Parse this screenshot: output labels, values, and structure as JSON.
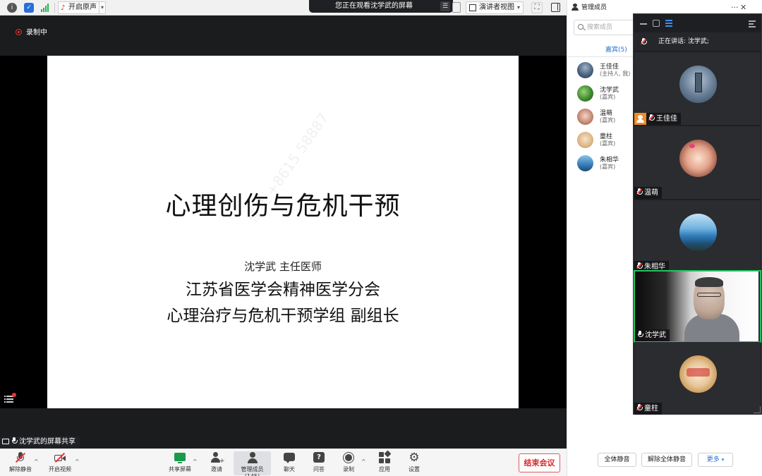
{
  "toolbar": {
    "original_sound": "开启原声",
    "presenter_view": "演讲者视图",
    "viewing_banner": "您正在观看沈学武的屏幕"
  },
  "recording": "录制中",
  "slide": {
    "title": "心理创伤与危机干预",
    "presenter": "沈学武  主任医师",
    "org": "江苏省医学会精神医学分会",
    "group": "心理治疗与危机干预学组  副组长",
    "watermark": "佳佳 +8615  58887"
  },
  "share_label": "沈学武的屏幕共享",
  "bottom": {
    "unmute": "解除静音",
    "video": "开启视频",
    "share": "共享屏幕",
    "invite": "邀请",
    "manage": "管理成员(145)",
    "chat": "聊天",
    "qa": "问答",
    "record": "录制",
    "apps": "应用",
    "settings": "设置",
    "end": "结束会议"
  },
  "panel": {
    "title": "管理成员",
    "search_placeholder": "搜索成员",
    "guests_tab": "嘉宾(5)",
    "members": [
      {
        "name": "王佳佳",
        "role": "(主持人, 我)"
      },
      {
        "name": "沈学武",
        "role": "(嘉宾)"
      },
      {
        "name": "温萌",
        "role": "(嘉宾)"
      },
      {
        "name": "童柱",
        "role": "(嘉宾)"
      },
      {
        "name": "朱相华",
        "role": "(嘉宾)"
      }
    ],
    "mute_all": "全体静音",
    "unmute_all": "解除全体静音",
    "more": "更多"
  },
  "gallery": {
    "speaking": "正在讲话: 沈学武;",
    "tiles": [
      {
        "name": "王佳佳"
      },
      {
        "name": "温萌"
      },
      {
        "name": "朱相华"
      },
      {
        "name": "沈学武"
      },
      {
        "name": "童柱"
      }
    ]
  },
  "colors": {
    "accent": "#2a6fd6",
    "danger": "#d6262a",
    "active_speaker": "#22c35e",
    "host_badge": "#f08a24"
  }
}
